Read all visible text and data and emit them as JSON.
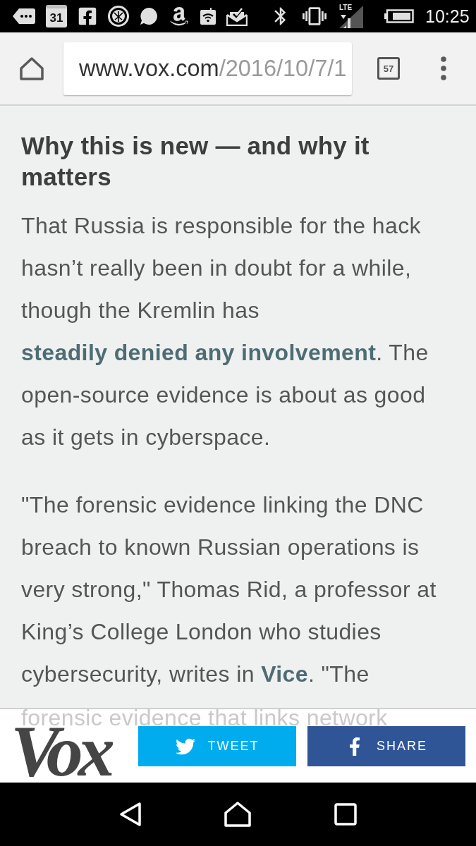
{
  "status_bar": {
    "calendar_day": "31",
    "network_type": "LTE",
    "time": "10:25"
  },
  "browser_toolbar": {
    "url_host": "www.vox.com",
    "url_path": "/2016/10/7/1",
    "tab_count": "57"
  },
  "article": {
    "heading": "Why this is new — and why it matters",
    "paragraphs": [
      {
        "segments": [
          {
            "kind": "text",
            "text": "That Russia is responsible for the hack hasn’t really been in doubt for a while, though the Kremlin has "
          },
          {
            "kind": "link",
            "text": "steadily denied any involvement"
          },
          {
            "kind": "text",
            "text": ". The open-source evidence is about as good as it gets in cyberspace."
          }
        ]
      },
      {
        "segments": [
          {
            "kind": "text",
            "text": "\"The forensic evidence linking the DNC breach to known Russian operations is very strong,\" Thomas Rid, a professor at King’s College London who studies cybersecurity, writes in "
          },
          {
            "kind": "link",
            "text": "Vice"
          },
          {
            "kind": "text",
            "text": ". \"The"
          }
        ]
      }
    ],
    "obscured_line": "forensic evidence that links network"
  },
  "share_bar": {
    "logo": "Vox",
    "buttons": [
      {
        "kind": "twitter",
        "label": "TWEET"
      },
      {
        "kind": "facebook",
        "label": "SHARE"
      }
    ]
  }
}
